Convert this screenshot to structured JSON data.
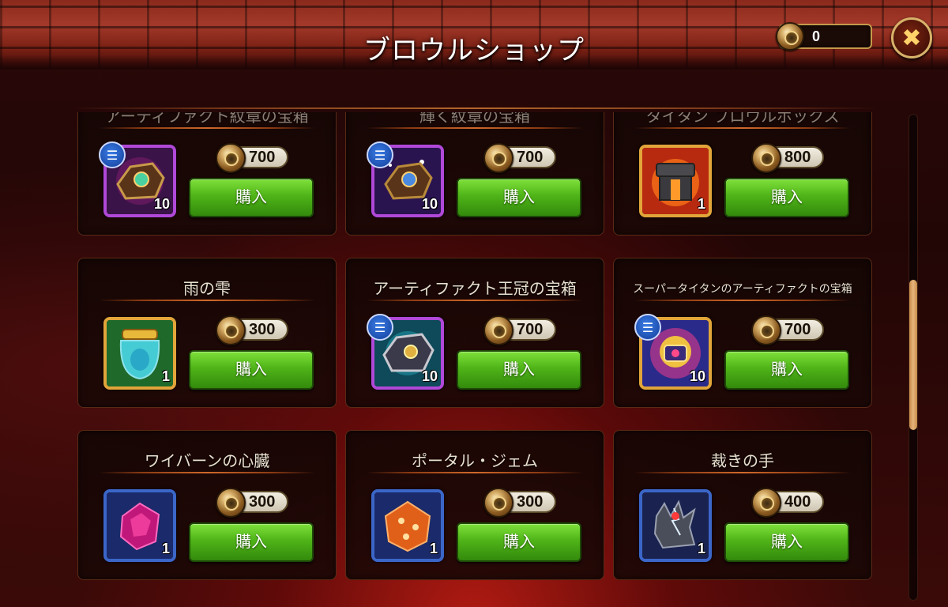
{
  "header": {
    "title": "ブロウルショップ",
    "currency_amount": "0",
    "close_symbol": "✖"
  },
  "colors": {
    "buy_green": "#4fb418",
    "epic_frame": "#b048d8",
    "legendary_frame": "#e2a53a",
    "rare_frame": "#3b66c8"
  },
  "items": [
    {
      "name": "アーティファクト紋章の宝箱",
      "price": "700",
      "quantity": "10",
      "rarity": "epic",
      "buy_label": "購入",
      "has_info": true
    },
    {
      "name": "輝く紋章の宝箱",
      "price": "700",
      "quantity": "10",
      "rarity": "epic",
      "buy_label": "購入",
      "has_info": true
    },
    {
      "name": "タイタン ブロウルボックス",
      "price": "800",
      "quantity": "1",
      "rarity": "legendary",
      "buy_label": "購入",
      "has_info": false
    },
    {
      "name": "雨の雫",
      "price": "300",
      "quantity": "1",
      "rarity": "legendary",
      "buy_label": "購入",
      "has_info": false
    },
    {
      "name": "アーティファクト王冠の宝箱",
      "price": "700",
      "quantity": "10",
      "rarity": "epic",
      "buy_label": "購入",
      "has_info": true
    },
    {
      "name": "スーパータイタンのアーティファクトの宝箱",
      "price": "700",
      "quantity": "10",
      "rarity": "legendary",
      "buy_label": "購入",
      "has_info": true
    },
    {
      "name": "ワイバーンの心臓",
      "price": "300",
      "quantity": "1",
      "rarity": "rare",
      "buy_label": "購入",
      "has_info": false
    },
    {
      "name": "ポータル・ジェム",
      "price": "300",
      "quantity": "1",
      "rarity": "rare",
      "buy_label": "購入",
      "has_info": false
    },
    {
      "name": "裁きの手",
      "price": "400",
      "quantity": "1",
      "rarity": "rare",
      "buy_label": "購入",
      "has_info": false
    }
  ]
}
